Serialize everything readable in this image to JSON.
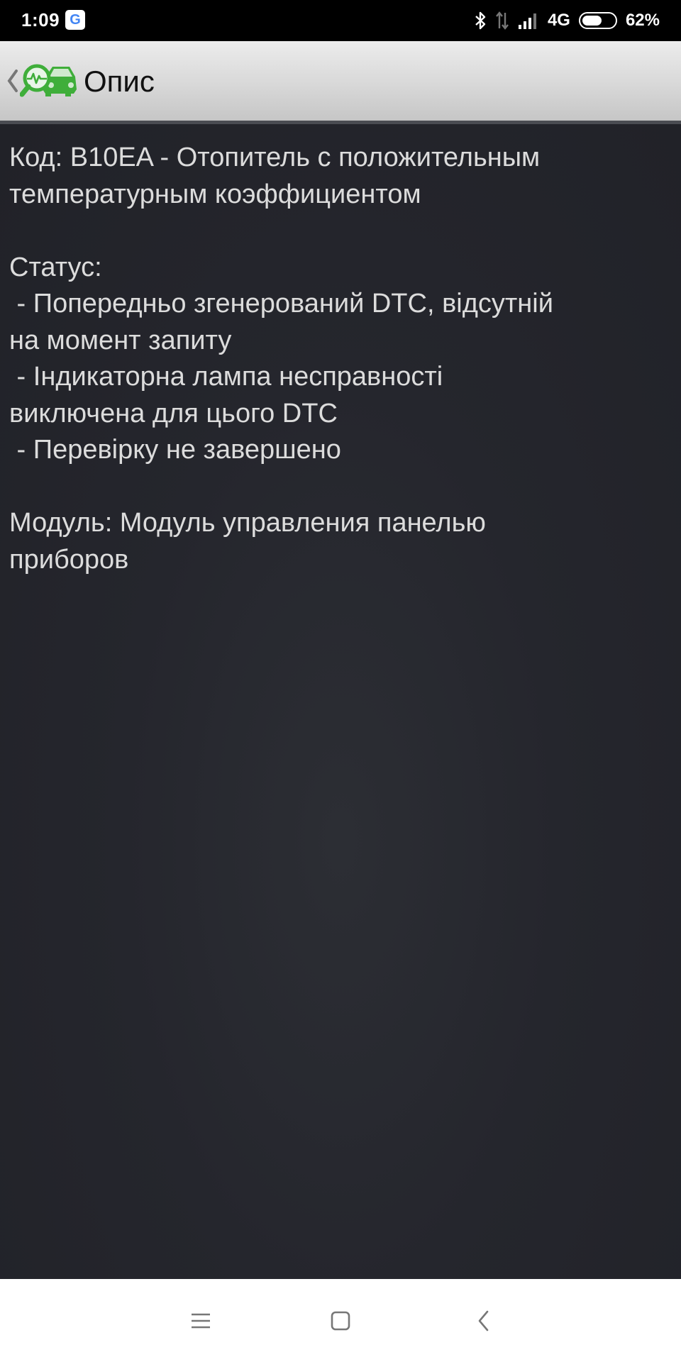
{
  "status_bar": {
    "time": "1:09",
    "google_badge": "G",
    "network": "4G",
    "battery_pct": "62%",
    "battery_level": 0.62,
    "icons": [
      "bluetooth-icon",
      "data-arrows-icon",
      "signal-icon",
      "battery-icon"
    ]
  },
  "app_bar": {
    "title": "Опис",
    "icons": [
      "back-chevron-icon",
      "car-diagnostics-logo-icon"
    ],
    "logo_color": "#3fae3a"
  },
  "description": {
    "lines": [
      "Код: B10EA - Отопитель с положительным",
      "температурным коэффициентом",
      "",
      "Статус:",
      " - Попередньо згенерований DTC, відсутній",
      "на момент запиту",
      " - Індикаторна лампа несправності",
      "виключена для цього DTC",
      " - Перевірку не завершено",
      "",
      "Модуль: Модуль управления панелью",
      "приборов"
    ]
  },
  "nav_bar": {
    "icons": [
      "menu-icon",
      "home-square-icon",
      "back-icon"
    ]
  },
  "colors": {
    "app_bar_bg": "#d8d8d8",
    "content_bg": "#25262d",
    "text": "#dcdcdc",
    "accent_green": "#3fae3a"
  }
}
